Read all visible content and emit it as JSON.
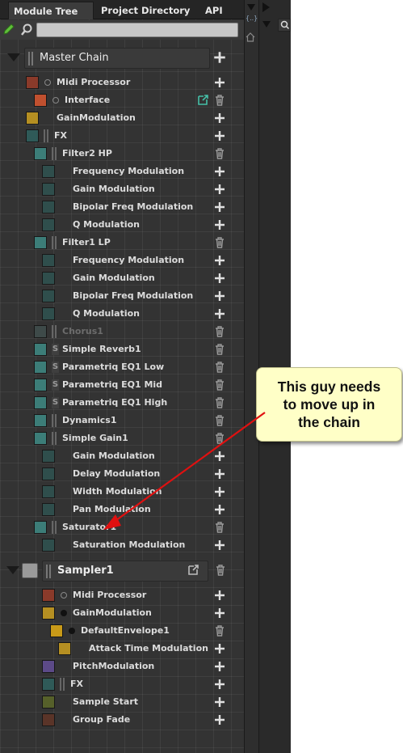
{
  "tabs": [
    "Module Tree",
    "Project Directory",
    "API"
  ],
  "search": {
    "placeholder": "",
    "value": ""
  },
  "right_strip": {
    "braces": "{..}"
  },
  "headers": {
    "master": "Master Chain",
    "sampler": "Sampler1"
  },
  "rows": {
    "midi": "Midi Processor",
    "interface": "Interface",
    "gainmod": "GainModulation",
    "fx": "FX",
    "filter2": "Filter2 HP",
    "f2_freq": "Frequency Modulation",
    "f2_gain": "Gain Modulation",
    "f2_bip": "Bipolar Freq Modulation",
    "f2_q": "Q Modulation",
    "filter1": "Filter1 LP",
    "f1_freq": "Frequency Modulation",
    "f1_gain": "Gain Modulation",
    "f1_bip": "Bipolar Freq Modulation",
    "f1_q": "Q Modulation",
    "chorus": "Chorus1",
    "reverb": "Simple Reverb1",
    "eq_low": "Parametriq EQ1 Low",
    "eq_mid": "Parametriq EQ1 Mid",
    "eq_high": "Parametriq EQ1 High",
    "dyn": "Dynamics1",
    "sgain": "Simple Gain1",
    "sg_gain": "Gain Modulation",
    "sg_delay": "Delay Modulation",
    "sg_width": "Width Modulation",
    "sg_pan": "Pan Modulation",
    "sat": "Saturator1",
    "sat_mod": "Saturation Modulation",
    "s_midi": "Midi Processor",
    "s_gainmod": "GainModulation",
    "s_env": "DefaultEnvelope1",
    "s_attack": "Attack Time Modulation",
    "s_pitch": "PitchModulation",
    "s_fx": "FX",
    "s_start": "Sample Start",
    "s_fade": "Group Fade"
  },
  "callout": {
    "line1": "This guy needs",
    "line2": "to move up in",
    "line3": "the chain"
  },
  "colors": {
    "panel": "#333333",
    "midi_red": "#8a3a2a",
    "interface_red": "#c0502f",
    "gain_yellow": "#b58f22",
    "fx_teal": "#2f5a58",
    "effect_teal": "#3c7d78",
    "mod_teal": "#2f4e4c",
    "pitch_purple": "#5c4a88",
    "sample_olive": "#56602a",
    "fade_brown": "#5a3428",
    "callout_bg": "#ffffc7",
    "arrow_red": "#e01010"
  }
}
